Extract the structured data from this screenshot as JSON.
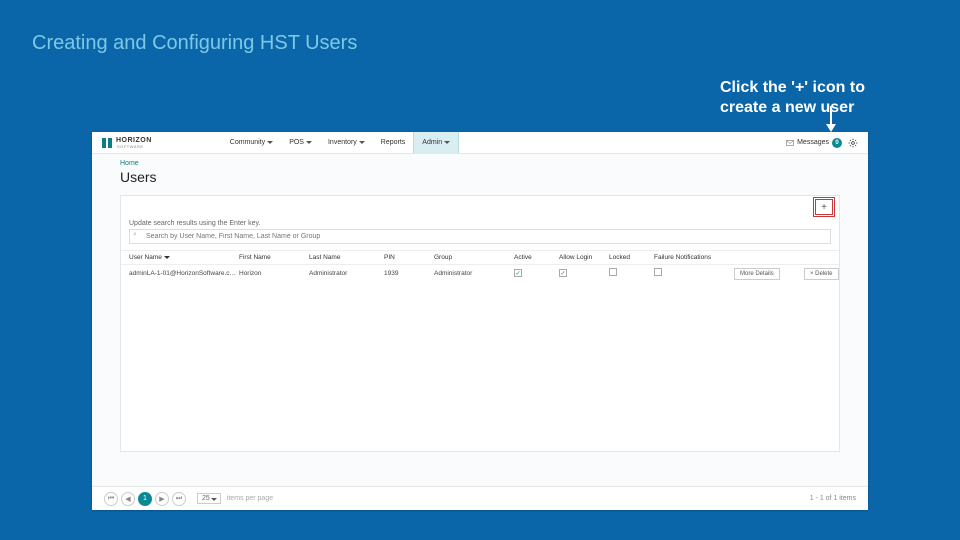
{
  "slide": {
    "title": "Creating  and Configuring HST Users",
    "callout_line1": "Click the '+' icon to",
    "callout_line2": "create a new user"
  },
  "brand": {
    "name": "HORIZON",
    "sub": "SOFTWARE"
  },
  "nav": {
    "items": [
      "Community",
      "POS",
      "Inventory",
      "Reports",
      "Admin"
    ],
    "active_index": 4
  },
  "topbar": {
    "messages_label": "Messages",
    "messages_count": "0"
  },
  "page": {
    "breadcrumb": "Home",
    "title": "Users",
    "search_hint": "Update search results using the Enter key.",
    "search_placeholder": "Search by User Name, First Name, Last Name or Group"
  },
  "add_button": {
    "label": "+"
  },
  "table": {
    "headers": {
      "user_name": "User Name",
      "first_name": "First Name",
      "last_name": "Last Name",
      "pin": "PIN",
      "group": "Group",
      "active": "Active",
      "allow_login": "Allow Login",
      "locked": "Locked",
      "failure_notifications": "Failure Notifications"
    },
    "rows": [
      {
        "user_name": "adminLA-1-01@HorizonSoftware.c…",
        "first_name": "Horizon",
        "last_name": "Administrator",
        "pin": "1939",
        "group": "Administrator",
        "active": true,
        "allow_login": true,
        "locked": false,
        "failure_notifications": false
      }
    ],
    "row_actions": {
      "more": "More Details",
      "delete": "× Delete"
    }
  },
  "pager": {
    "current": "1",
    "page_size": "25",
    "per_label": "items per page",
    "range": "1 - 1 of 1 items"
  }
}
